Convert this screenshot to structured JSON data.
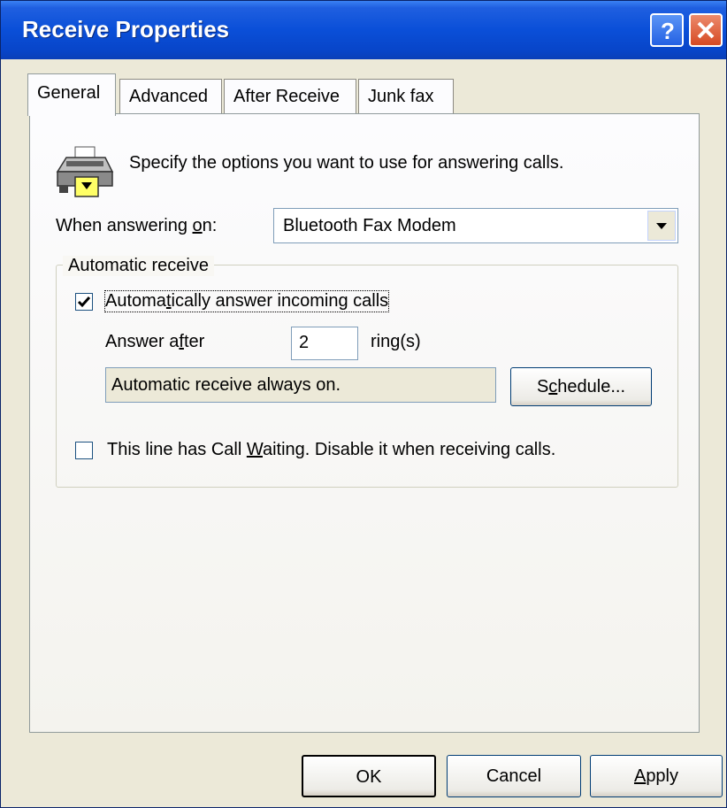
{
  "window": {
    "title": "Receive Properties",
    "help_button": "?",
    "close_button": "X"
  },
  "tabs": [
    {
      "label": "General",
      "active": true
    },
    {
      "label": "Advanced",
      "active": false
    },
    {
      "label": "After Receive",
      "active": false
    },
    {
      "label": "Junk fax",
      "active": false
    }
  ],
  "general": {
    "intro_text": "Specify the options you want to use for answering calls.",
    "answering_on_label_pre": "When answering ",
    "answering_on_label_key": "o",
    "answering_on_label_post": "n:",
    "device_selected": "Bluetooth Fax Modem",
    "group_title": "Automatic receive",
    "auto_answer_pre": "Automa",
    "auto_answer_key": "t",
    "auto_answer_post": "ically answer incoming calls",
    "auto_answer_checked": true,
    "answer_after_pre": "Answer a",
    "answer_after_key": "f",
    "answer_after_post": "ter",
    "rings_value": "2",
    "rings_label": "ring(s)",
    "status_text": "Automatic receive always on.",
    "schedule_pre": "S",
    "schedule_key": "c",
    "schedule_post": "hedule...",
    "call_waiting_pre": "This line has Call ",
    "call_waiting_key": "W",
    "call_waiting_post": "aiting. Disable it when receiving calls.",
    "call_waiting_checked": false
  },
  "buttons": {
    "ok": "OK",
    "cancel": "Cancel",
    "apply_key": "A",
    "apply_post": "pply"
  },
  "colors": {
    "titlebar": "#0a4fd8",
    "face": "#ece9d8",
    "border_blue": "#7f9db9"
  }
}
